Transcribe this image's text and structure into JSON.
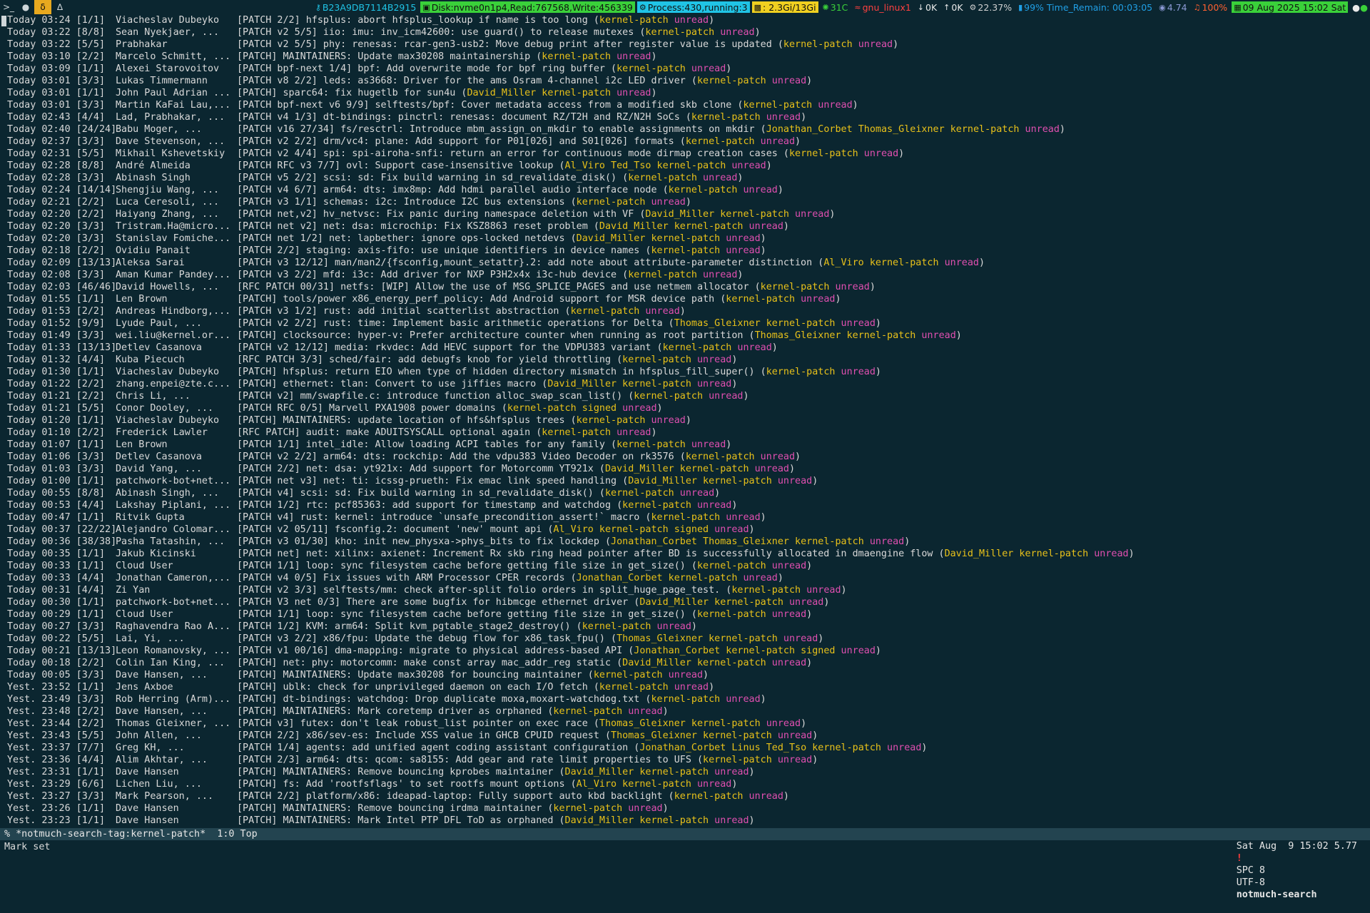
{
  "topbar": {
    "workspaces": [
      "1",
      "2",
      "3",
      "4"
    ],
    "id": "B23A9DB7114B2915",
    "disk": "Disk:nvme0n1p4,Read:767568,Write:456339",
    "process": "Process:430,running:3",
    "mem": ": 2.3Gi/13Gi",
    "temp": "31C",
    "net": "gnu_linux1",
    "down": "0K",
    "up": "0K",
    "cpu": "22.37%",
    "battery": "99% Time_Remain: 00:03:05",
    "load": "4.74",
    "volume": "100%",
    "date": "09 Aug 2025 15:02 Sat",
    "colors": {
      "disk": "#3ad13a",
      "process": "#20c4e6",
      "mem": "#f0d020",
      "date": "#3ad13a",
      "net": "#ff4040",
      "volume": "#ff6030"
    }
  },
  "messages": [
    {
      "d": "Today 03:24",
      "c": "[1/1]",
      "a": "Viacheslav Dubeyko",
      "s": "[PATCH 2/2] hfsplus: abort hfsplus_lookup if name is too long",
      "t": [
        "kernel-patch"
      ]
    },
    {
      "d": "Today 03:22",
      "c": "[8/8]",
      "a": "Sean Nyekjaer, ...",
      "s": "[PATCH v2 5/5] iio: imu: inv_icm42600: use guard() to release mutexes",
      "t": [
        "kernel-patch"
      ]
    },
    {
      "d": "Today 03:22",
      "c": "[5/5]",
      "a": "Prabhakar",
      "s": "[PATCH v2 5/5] phy: renesas: rcar-gen3-usb2: Move debug print after register value is updated",
      "t": [
        "kernel-patch"
      ]
    },
    {
      "d": "Today 03:10",
      "c": "[2/2]",
      "a": "Marcelo Schmitt, ...",
      "s": "[PATCH] MAINTAINERS: Update max30208 maintainership",
      "t": [
        "kernel-patch"
      ]
    },
    {
      "d": "Today 03:09",
      "c": "[1/1]",
      "a": "Alexei Starovoitov",
      "s": "[PATCH bpf-next 1/4] bpf: Add overwrite mode for bpf ring buffer",
      "t": [
        "kernel-patch"
      ]
    },
    {
      "d": "Today 03:01",
      "c": "[3/3]",
      "a": "Lukas Timmermann",
      "s": "[PATCH v8 2/2] leds: as3668: Driver for the ams Osram 4-channel i2c LED driver",
      "t": [
        "kernel-patch"
      ]
    },
    {
      "d": "Today 03:01",
      "c": "[1/1]",
      "a": "John Paul Adrian ...",
      "s": "[PATCH] sparc64: fix hugetlb for sun4u",
      "t": [
        "David_Miller",
        "kernel-patch"
      ]
    },
    {
      "d": "Today 03:01",
      "c": "[3/3]",
      "a": "Martin KaFai Lau,...",
      "s": "[PATCH bpf-next v6 9/9] selftests/bpf: Cover metadata access from a modified skb clone",
      "t": [
        "kernel-patch"
      ]
    },
    {
      "d": "Today 02:43",
      "c": "[4/4]",
      "a": "Lad, Prabhakar, ...",
      "s": "[PATCH v4 1/3] dt-bindings: pinctrl: renesas: document RZ/T2H and RZ/N2H SoCs",
      "t": [
        "kernel-patch"
      ]
    },
    {
      "d": "Today 02:40",
      "c": "[24/24]",
      "a": "Babu Moger, ...",
      "s": "[PATCH v16 27/34] fs/resctrl: Introduce mbm_assign_on_mkdir to enable assignments on mkdir",
      "t": [
        "Jonathan_Corbet",
        "Thomas_Gleixner",
        "kernel-patch"
      ]
    },
    {
      "d": "Today 02:37",
      "c": "[3/3]",
      "a": "Dave Stevenson, ...",
      "s": "[PATCH v2 2/2] drm/vc4: plane: Add support for P01[026] and S01[026] formats",
      "t": [
        "kernel-patch"
      ]
    },
    {
      "d": "Today 02:31",
      "c": "[5/5]",
      "a": "Mikhail Kshevetskiy",
      "s": "[PATCH v2 4/4] spi: spi-airoha-snfi: return an error for continuous mode dirmap creation cases",
      "t": [
        "kernel-patch"
      ]
    },
    {
      "d": "Today 02:28",
      "c": "[8/8]",
      "a": "André Almeida",
      "s": "[PATCH RFC v3 7/7] ovl: Support case-insensitive lookup",
      "t": [
        "Al_Viro",
        "Ted_Tso",
        "kernel-patch"
      ]
    },
    {
      "d": "Today 02:28",
      "c": "[3/3]",
      "a": "Abinash Singh",
      "s": "[PATCH v5 2/2] scsi: sd: Fix build warning in sd_revalidate_disk()",
      "t": [
        "kernel-patch"
      ]
    },
    {
      "d": "Today 02:24",
      "c": "[14/14]",
      "a": "Shengjiu Wang, ...",
      "s": "[PATCH v4 6/7] arm64: dts: imx8mp: Add hdmi parallel audio interface node",
      "t": [
        "kernel-patch"
      ]
    },
    {
      "d": "Today 02:21",
      "c": "[2/2]",
      "a": "Luca Ceresoli, ...",
      "s": "[PATCH v3 1/1] schemas: i2c: Introduce I2C bus extensions",
      "t": [
        "kernel-patch"
      ]
    },
    {
      "d": "Today 02:20",
      "c": "[2/2]",
      "a": "Haiyang Zhang, ...",
      "s": "[PATCH net,v2] hv_netvsc: Fix panic during namespace deletion with VF",
      "t": [
        "David_Miller",
        "kernel-patch"
      ]
    },
    {
      "d": "Today 02:20",
      "c": "[3/3]",
      "a": "Tristram.Ha@micro...",
      "s": "[PATCH net v2] net: dsa: microchip: Fix KSZ8863 reset problem",
      "t": [
        "David_Miller",
        "kernel-patch"
      ]
    },
    {
      "d": "Today 02:20",
      "c": "[3/3]",
      "a": "Stanislav Fomiche...",
      "s": "[PATCH net 1/2] net: lapbether: ignore ops-locked netdevs",
      "t": [
        "David_Miller",
        "kernel-patch"
      ]
    },
    {
      "d": "Today 02:18",
      "c": "[2/2]",
      "a": "Ovidiu Panait",
      "s": "[PATCH 2/2] staging: axis-fifo: use unique identifiers in device names",
      "t": [
        "kernel-patch"
      ]
    },
    {
      "d": "Today 02:09",
      "c": "[13/13]",
      "a": "Aleksa Sarai",
      "s": "[PATCH v3 12/12] man/man2/{fsconfig,mount_setattr}.2: add note about attribute-parameter distinction",
      "t": [
        "Al_Viro",
        "kernel-patch"
      ]
    },
    {
      "d": "Today 02:08",
      "c": "[3/3]",
      "a": "Aman Kumar Pandey...",
      "s": "[PATCH v3 2/2] mfd: i3c: Add driver for NXP P3H2x4x i3c-hub device",
      "t": [
        "kernel-patch"
      ]
    },
    {
      "d": "Today 02:03",
      "c": "[46/46]",
      "a": "David Howells, ...",
      "s": "[RFC PATCH 00/31] netfs: [WIP] Allow the use of MSG_SPLICE_PAGES and use netmem allocator",
      "t": [
        "kernel-patch"
      ]
    },
    {
      "d": "Today 01:55",
      "c": "[1/1]",
      "a": "Len Brown",
      "s": "[PATCH] tools/power x86_energy_perf_policy: Add Android support for MSR device path",
      "t": [
        "kernel-patch"
      ]
    },
    {
      "d": "Today 01:53",
      "c": "[2/2]",
      "a": "Andreas Hindborg,...",
      "s": "[PATCH v3 1/2] rust: add initial scatterlist abstraction",
      "t": [
        "kernel-patch"
      ]
    },
    {
      "d": "Today 01:52",
      "c": "[9/9]",
      "a": "Lyude Paul, ...",
      "s": "[PATCH v2 2/2] rust: time: Implement basic arithmetic operations for Delta",
      "t": [
        "Thomas_Gleixner",
        "kernel-patch"
      ]
    },
    {
      "d": "Today 01:49",
      "c": "[3/3]",
      "a": "wei.liu@kernel.or...",
      "s": "[PATCH] clocksource: hyper-v: Prefer architecture counter when running as root partition",
      "t": [
        "Thomas_Gleixner",
        "kernel-patch"
      ]
    },
    {
      "d": "Today 01:33",
      "c": "[13/13]",
      "a": "Detlev Casanova",
      "s": "[PATCH v2 12/12] media: rkvdec: Add HEVC support for the VDPU383 variant",
      "t": [
        "kernel-patch"
      ]
    },
    {
      "d": "Today 01:32",
      "c": "[4/4]",
      "a": "Kuba Piecuch",
      "s": "[RFC PATCH 3/3] sched/fair: add debugfs knob for yield throttling",
      "t": [
        "kernel-patch"
      ]
    },
    {
      "d": "Today 01:30",
      "c": "[1/1]",
      "a": "Viacheslav Dubeyko",
      "s": "[PATCH] hfsplus: return EIO when type of hidden directory mismatch in hfsplus_fill_super()",
      "t": [
        "kernel-patch"
      ]
    },
    {
      "d": "Today 01:22",
      "c": "[2/2]",
      "a": "zhang.enpei@zte.c...",
      "s": "[PATCH] ethernet: tlan: Convert to use jiffies macro",
      "t": [
        "David_Miller",
        "kernel-patch"
      ]
    },
    {
      "d": "Today 01:21",
      "c": "[2/2]",
      "a": "Chris Li, ...",
      "s": "[PATCH v2] mm/swapfile.c: introduce function alloc_swap_scan_list()",
      "t": [
        "kernel-patch"
      ]
    },
    {
      "d": "Today 01:21",
      "c": "[5/5]",
      "a": "Conor Dooley, ...",
      "s": "[PATCH RFC 0/5] Marvell PXA1908 power domains",
      "t": [
        "kernel-patch",
        "signed"
      ]
    },
    {
      "d": "Today 01:20",
      "c": "[1/1]",
      "a": "Viacheslav Dubeyko",
      "s": "[PATCH] MAINTAINERS: update location of hfs&hfsplus trees",
      "t": [
        "kernel-patch"
      ]
    },
    {
      "d": "Today 01:10",
      "c": "[2/2]",
      "a": "Frederick Lawler",
      "s": "[RFC PATCH] audit: make ADUITSYSCALL optional again",
      "t": [
        "kernel-patch"
      ]
    },
    {
      "d": "Today 01:07",
      "c": "[1/1]",
      "a": "Len Brown",
      "s": "[PATCH 1/1] intel_idle: Allow loading ACPI tables for any family",
      "t": [
        "kernel-patch"
      ]
    },
    {
      "d": "Today 01:06",
      "c": "[3/3]",
      "a": "Detlev Casanova",
      "s": "[PATCH v2 2/2] arm64: dts: rockchip: Add the vdpu383 Video Decoder on rk3576",
      "t": [
        "kernel-patch"
      ]
    },
    {
      "d": "Today 01:03",
      "c": "[3/3]",
      "a": "David Yang, ...",
      "s": "[PATCH 2/2] net: dsa: yt921x: Add support for Motorcomm YT921x",
      "t": [
        "David_Miller",
        "kernel-patch"
      ]
    },
    {
      "d": "Today 01:00",
      "c": "[1/1]",
      "a": "patchwork-bot+net...",
      "s": "[PATCH net v3] net: ti: icssg-prueth: Fix emac link speed handling",
      "t": [
        "David_Miller",
        "kernel-patch"
      ]
    },
    {
      "d": "Today 00:55",
      "c": "[8/8]",
      "a": "Abinash Singh, ...",
      "s": "[PATCH v4] scsi: sd: Fix build warning in sd_revalidate_disk()",
      "t": [
        "kernel-patch"
      ]
    },
    {
      "d": "Today 00:53",
      "c": "[4/4]",
      "a": "Lakshay Piplani, ...",
      "s": "[PATCH 1/2] rtc: pcf85363: add support for timestamp and watchdog",
      "t": [
        "kernel-patch"
      ]
    },
    {
      "d": "Today 00:47",
      "c": "[1/1]",
      "a": "Ritvik Gupta",
      "s": "[PATCH v4] rust: kernel: introduce `unsafe_precondition_assert!` macro",
      "t": [
        "kernel-patch"
      ]
    },
    {
      "d": "Today 00:37",
      "c": "[22/22]",
      "a": "Alejandro Colomar...",
      "s": "[PATCH v2 05/11] fsconfig.2: document 'new' mount api",
      "t": [
        "Al_Viro",
        "kernel-patch",
        "signed"
      ]
    },
    {
      "d": "Today 00:36",
      "c": "[38/38]",
      "a": "Pasha Tatashin, ...",
      "s": "[PATCH v3 01/30] kho: init new_physxa->phys_bits to fix lockdep",
      "t": [
        "Jonathan_Corbet",
        "Thomas_Gleixner",
        "kernel-patch"
      ]
    },
    {
      "d": "Today 00:35",
      "c": "[1/1]",
      "a": "Jakub Kicinski",
      "s": "[PATCH net] net: xilinx: axienet: Increment Rx skb ring head pointer after BD is successfully allocated in dmaengine flow",
      "t": [
        "David_Miller",
        "kernel-patch"
      ]
    },
    {
      "d": "Today 00:33",
      "c": "[1/1]",
      "a": "Cloud User",
      "s": "[PATCH 1/1] loop: sync filesystem cache before getting file size in get_size()",
      "t": [
        "kernel-patch"
      ]
    },
    {
      "d": "Today 00:33",
      "c": "[4/4]",
      "a": "Jonathan Cameron,...",
      "s": "[PATCH v4 0/5] Fix issues with ARM Processor CPER records",
      "t": [
        "Jonathan_Corbet",
        "kernel-patch"
      ]
    },
    {
      "d": "Today 00:31",
      "c": "[4/4]",
      "a": "Zi Yan",
      "s": "[PATCH v2 3/3] selftests/mm: check after-split folio orders in split_huge_page_test.",
      "t": [
        "kernel-patch"
      ]
    },
    {
      "d": "Today 00:30",
      "c": "[1/1]",
      "a": "patchwork-bot+net...",
      "s": "[PATCH V3 net 0/3] There are some bugfix for hibmcge ethernet driver",
      "t": [
        "David_Miller",
        "kernel-patch"
      ]
    },
    {
      "d": "Today 00:29",
      "c": "[1/1]",
      "a": "Cloud User",
      "s": "[PATCH 1/1] loop: sync filesystem cache before getting file size in get_size()",
      "t": [
        "kernel-patch"
      ]
    },
    {
      "d": "Today 00:27",
      "c": "[3/3]",
      "a": "Raghavendra Rao A...",
      "s": "[PATCH 1/2] KVM: arm64: Split kvm_pgtable_stage2_destroy()",
      "t": [
        "kernel-patch"
      ]
    },
    {
      "d": "Today 00:22",
      "c": "[5/5]",
      "a": "Lai, Yi, ...",
      "s": "[PATCH v3 2/2] x86/fpu: Update the debug flow for x86_task_fpu()",
      "t": [
        "Thomas_Gleixner",
        "kernel-patch"
      ]
    },
    {
      "d": "Today 00:21",
      "c": "[13/13]",
      "a": "Leon Romanovsky, ...",
      "s": "[PATCH v1 00/16] dma-mapping: migrate to physical address-based API",
      "t": [
        "Jonathan_Corbet",
        "kernel-patch",
        "signed"
      ]
    },
    {
      "d": "Today 00:18",
      "c": "[2/2]",
      "a": "Colin Ian King, ...",
      "s": "[PATCH] net: phy: motorcomm: make const array mac_addr_reg static",
      "t": [
        "David_Miller",
        "kernel-patch"
      ]
    },
    {
      "d": "Today 00:05",
      "c": "[3/3]",
      "a": "Dave Hansen, ...",
      "s": "[PATCH] MAINTAINERS: Update max30208 for bouncing maintainer",
      "t": [
        "kernel-patch"
      ]
    },
    {
      "d": "Yest. 23:52",
      "c": "[1/1]",
      "a": "Jens Axboe",
      "s": "[PATCH] ublk: check for unprivileged daemon on each I/O fetch",
      "t": [
        "kernel-patch"
      ]
    },
    {
      "d": "Yest. 23:49",
      "c": "[3/3]",
      "a": "Rob Herring (Arm)...",
      "s": "[PATCH] dt-bindings: watchdog: Drop duplicate moxa,moxart-watchdog.txt",
      "t": [
        "kernel-patch"
      ]
    },
    {
      "d": "Yest. 23:48",
      "c": "[2/2]",
      "a": "Dave Hansen, ...",
      "s": "[PATCH] MAINTAINERS: Mark coretemp driver as orphaned",
      "t": [
        "kernel-patch"
      ]
    },
    {
      "d": "Yest. 23:44",
      "c": "[2/2]",
      "a": "Thomas Gleixner, ...",
      "s": "[PATCH v3] futex: don't leak robust_list pointer on exec race",
      "t": [
        "Thomas_Gleixner",
        "kernel-patch"
      ]
    },
    {
      "d": "Yest. 23:43",
      "c": "[5/5]",
      "a": "John Allen, ...",
      "s": "[PATCH 2/2] x86/sev-es: Include XSS value in GHCB CPUID request",
      "t": [
        "Thomas_Gleixner",
        "kernel-patch"
      ]
    },
    {
      "d": "Yest. 23:37",
      "c": "[7/7]",
      "a": "Greg KH, ...",
      "s": "[PATCH 1/4] agents: add unified agent coding assistant configuration",
      "t": [
        "Jonathan_Corbet",
        "Linus",
        "Ted_Tso",
        "kernel-patch"
      ]
    },
    {
      "d": "Yest. 23:36",
      "c": "[4/4]",
      "a": "Alim Akhtar, ...",
      "s": "[PATCH 2/3] arm64: dts: qcom: sa8155: Add gear and rate limit properties to UFS",
      "t": [
        "kernel-patch"
      ]
    },
    {
      "d": "Yest. 23:31",
      "c": "[1/1]",
      "a": "Dave Hansen",
      "s": "[PATCH] MAINTAINERS: Remove bouncing kprobes maintainer",
      "t": [
        "David_Miller",
        "kernel-patch"
      ]
    },
    {
      "d": "Yest. 23:29",
      "c": "[6/6]",
      "a": "Lichen Liu, ...",
      "s": "[PATCH] fs: Add 'rootfsflags' to set rootfs mount options",
      "t": [
        "Al_Viro",
        "kernel-patch"
      ]
    },
    {
      "d": "Yest. 23:27",
      "c": "[3/3]",
      "a": "Mark Pearson, ...",
      "s": "[PATCH 2/2] platform/x86: ideapad-laptop: Fully support auto kbd backlight",
      "t": [
        "kernel-patch"
      ]
    },
    {
      "d": "Yest. 23:26",
      "c": "[1/1]",
      "a": "Dave Hansen",
      "s": "[PATCH] MAINTAINERS: Remove bouncing irdma maintainer",
      "t": [
        "kernel-patch"
      ]
    },
    {
      "d": "Yest. 23:23",
      "c": "[1/1]",
      "a": "Dave Hansen",
      "s": "[PATCH] MAINTAINERS: Mark Intel PTP DFL ToD as orphaned",
      "t": [
        "David_Miller",
        "kernel-patch"
      ]
    }
  ],
  "unread_tag": "unread",
  "modeline": {
    "left": "% *notmuch-search-tag:kernel-patch*  1:0 Top",
    "datetime": "Sat Aug  9 15:02 5.77",
    "warn": "!",
    "spc": "SPC 8",
    "enc": "UTF-8",
    "mode": "notmuch-search"
  },
  "echo": "Mark set"
}
